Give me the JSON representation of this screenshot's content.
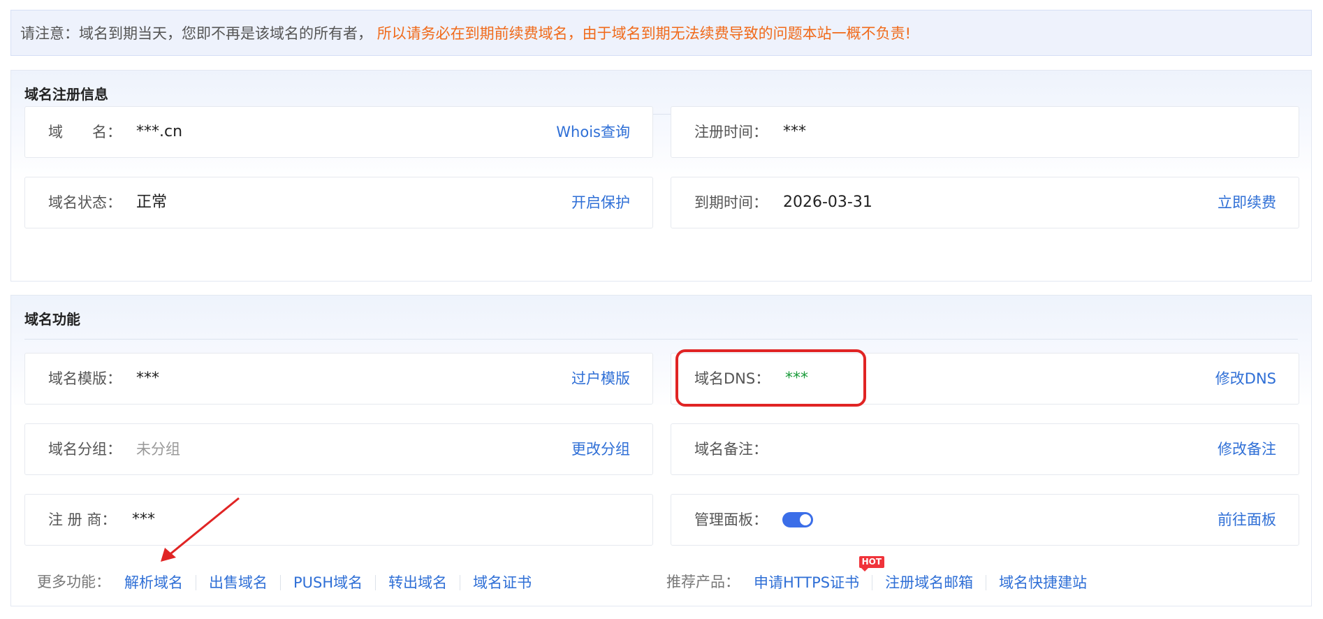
{
  "notice": {
    "lead": "请注意：域名到期当天，您即不再是该域名的所有者，",
    "warning": "所以请务必在到期前续费域名，由于域名到期无法续费导致的问题本站一概不负责!"
  },
  "registration": {
    "title": "域名注册信息",
    "domain": {
      "label": "域　　名：",
      "value": "***.cn",
      "action": "Whois查询"
    },
    "reg_time": {
      "label": "注册时间：",
      "value": "***"
    },
    "status": {
      "label": "域名状态：",
      "value": "正常",
      "action": "开启保护"
    },
    "expire": {
      "label": "到期时间：",
      "value": "2026-03-31",
      "action": "立即续费"
    }
  },
  "features": {
    "title": "域名功能",
    "template": {
      "label": "域名模版：",
      "value": "***",
      "action": "过户模版"
    },
    "dns": {
      "label": "域名DNS：",
      "value": "***",
      "action": "修改DNS"
    },
    "group": {
      "label": "域名分组：",
      "value": "未分组",
      "action": "更改分组"
    },
    "remark": {
      "label": "域名备注：",
      "value": "",
      "action": "修改备注"
    },
    "registrar": {
      "label": "注 册 商：",
      "value": "***"
    },
    "panel": {
      "label": "管理面板：",
      "enabled": true,
      "action": "前往面板"
    },
    "more": {
      "label": "更多功能：",
      "links": [
        "解析域名",
        "出售域名",
        "PUSH域名",
        "转出域名",
        "域名证书"
      ]
    },
    "recommend": {
      "label": "推荐产品：",
      "links": [
        "申请HTTPS证书",
        "注册域名邮箱",
        "域名快捷建站"
      ],
      "badge": "HOT"
    }
  },
  "colors": {
    "link": "#2f6fd6",
    "warning": "#f06a1a",
    "dns_value": "#1a9b3a",
    "highlight": "#e02424",
    "toggle": "#3b6ee8"
  }
}
